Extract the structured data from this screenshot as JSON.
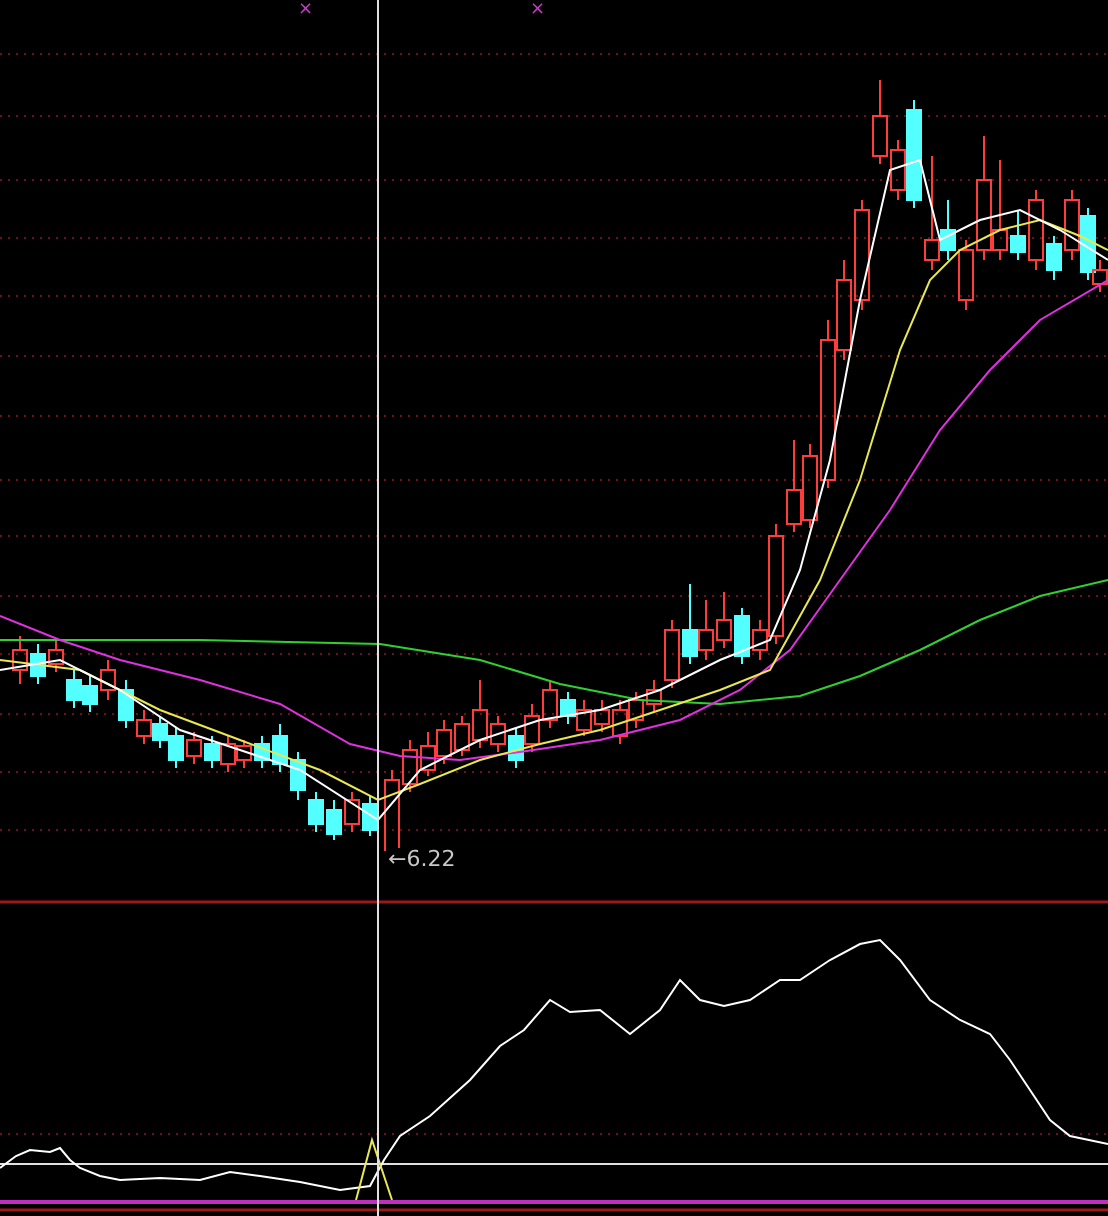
{
  "chart_markers": [
    "×",
    "×"
  ],
  "price_panel": {
    "low_label": "←6.22"
  }
}
